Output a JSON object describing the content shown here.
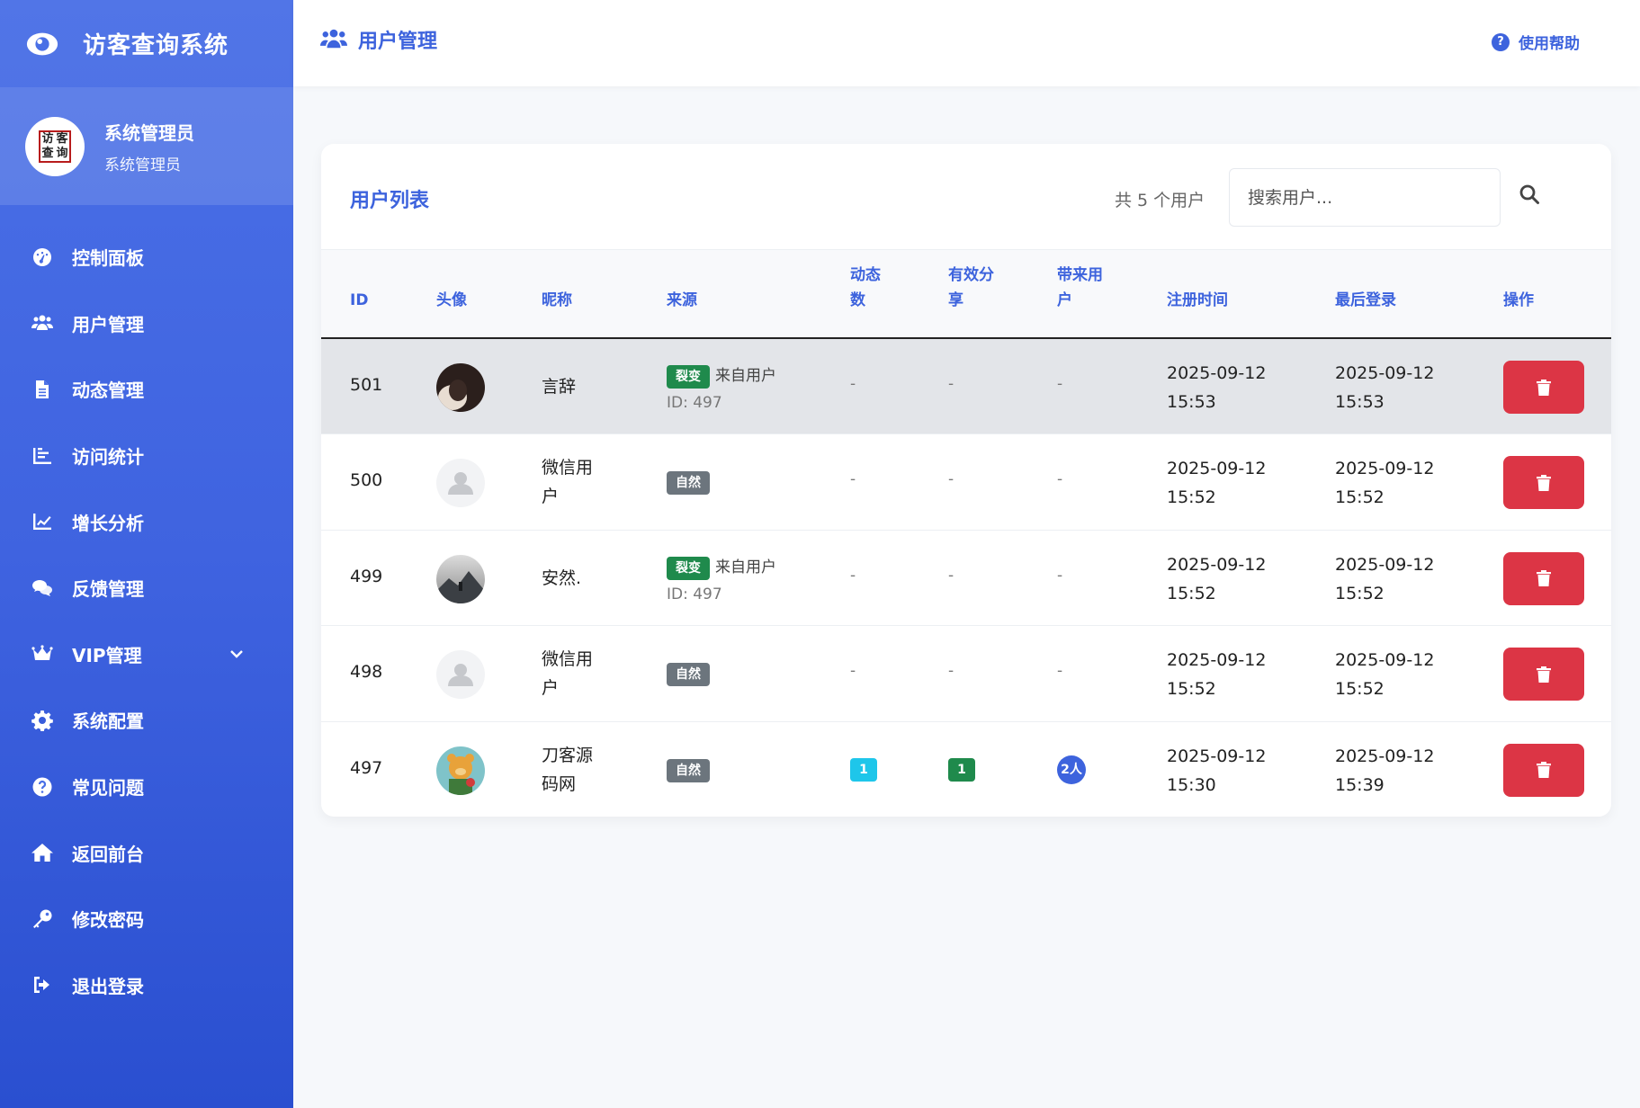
{
  "app": {
    "title": "访客查询系统",
    "logo_seal": [
      "访",
      "客",
      "查",
      "询"
    ]
  },
  "profile": {
    "name": "系统管理员",
    "role": "系统管理员"
  },
  "nav": [
    {
      "label": "控制面板",
      "icon": "dashboard-icon"
    },
    {
      "label": "用户管理",
      "icon": "users-icon"
    },
    {
      "label": "动态管理",
      "icon": "file-icon"
    },
    {
      "label": "访问统计",
      "icon": "bar-chart-icon"
    },
    {
      "label": "增长分析",
      "icon": "line-chart-icon"
    },
    {
      "label": "反馈管理",
      "icon": "comments-icon"
    },
    {
      "label": "VIP管理",
      "icon": "crown-icon"
    },
    {
      "label": "系统配置",
      "icon": "gear-icon"
    },
    {
      "label": "常见问题",
      "icon": "question-icon"
    },
    {
      "label": "返回前台",
      "icon": "home-icon"
    },
    {
      "label": "修改密码",
      "icon": "key-icon"
    },
    {
      "label": "退出登录",
      "icon": "logout-icon"
    }
  ],
  "topbar": {
    "title": "用户管理",
    "help": "使用帮助",
    "help_glyph": "?"
  },
  "card": {
    "title": "用户列表",
    "count": "共 5 个用户",
    "search_placeholder": "搜索用户..."
  },
  "columns": {
    "id": "ID",
    "avatar": "头像",
    "nickname": "昵称",
    "source": "来源",
    "posts_1": "动态",
    "posts_2": "数",
    "shares_1": "有效分",
    "shares_2": "享",
    "brought_1": "带来用",
    "brought_2": "户",
    "registered": "注册时间",
    "last_login": "最后登录",
    "actions": "操作"
  },
  "rows": [
    {
      "id": "501",
      "avatar": "photo-dark",
      "nick_1": "言辞",
      "nick_2": "",
      "source_badge": "裂变",
      "source_kind": "fission",
      "source_from": "来自用户",
      "source_id": "ID: 497",
      "posts": "-",
      "shares": "-",
      "brought": "-",
      "reg_date": "2025-09-12",
      "reg_time": "15:53",
      "login_date": "2025-09-12",
      "login_time": "15:53"
    },
    {
      "id": "500",
      "avatar": "default-user",
      "nick_1": "微信用",
      "nick_2": "户",
      "source_badge": "自然",
      "source_kind": "natural",
      "source_from": "",
      "source_id": "",
      "posts": "-",
      "shares": "-",
      "brought": "-",
      "reg_date": "2025-09-12",
      "reg_time": "15:52",
      "login_date": "2025-09-12",
      "login_time": "15:52"
    },
    {
      "id": "499",
      "avatar": "photo-landscape",
      "nick_1": "安然.",
      "nick_2": "",
      "source_badge": "裂变",
      "source_kind": "fission",
      "source_from": "来自用户",
      "source_id": "ID: 497",
      "posts": "-",
      "shares": "-",
      "brought": "-",
      "reg_date": "2025-09-12",
      "reg_time": "15:52",
      "login_date": "2025-09-12",
      "login_time": "15:52"
    },
    {
      "id": "498",
      "avatar": "default-user",
      "nick_1": "微信用",
      "nick_2": "户",
      "source_badge": "自然",
      "source_kind": "natural",
      "source_from": "",
      "source_id": "",
      "posts": "-",
      "shares": "-",
      "brought": "-",
      "reg_date": "2025-09-12",
      "reg_time": "15:52",
      "login_date": "2025-09-12",
      "login_time": "15:52"
    },
    {
      "id": "497",
      "avatar": "photo-cartoon-bear",
      "nick_1": "刀客源",
      "nick_2": "码网",
      "source_badge": "自然",
      "source_kind": "natural",
      "source_from": "",
      "source_id": "",
      "posts": "1",
      "shares": "1",
      "brought": "2人",
      "reg_date": "2025-09-12",
      "reg_time": "15:30",
      "login_date": "2025-09-12",
      "login_time": "15:39"
    }
  ],
  "colors": {
    "accent": "#3d63dd",
    "sidebar_top": "#4a70e6",
    "sidebar_bottom": "#2a4fd0",
    "danger": "#dc3545",
    "fission_badge": "#1f8a4c",
    "natural_badge": "#6c757d",
    "posts_pill": "#1ec6ea",
    "shares_pill": "#1f8a4c",
    "brought_pill": "#3d63dd"
  }
}
